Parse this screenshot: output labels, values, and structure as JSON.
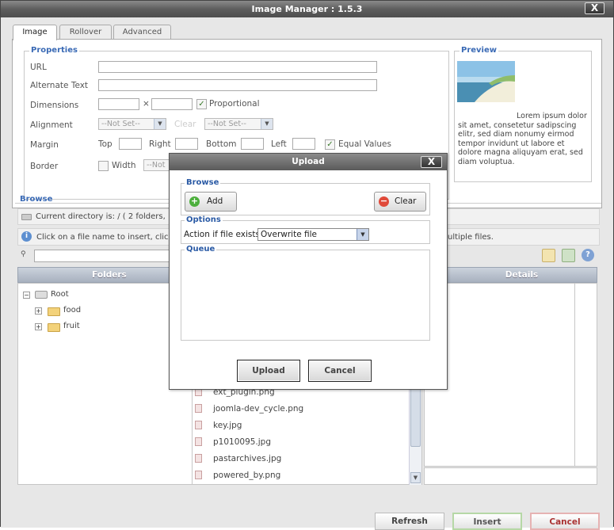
{
  "window": {
    "title": "Image Manager : 1.5.3",
    "close_label": "X"
  },
  "tabs": [
    {
      "label": "Image",
      "active": true
    },
    {
      "label": "Rollover"
    },
    {
      "label": "Advanced"
    }
  ],
  "properties": {
    "legend": "Properties",
    "url_label": "URL",
    "alt_label": "Alternate Text",
    "dimensions_label": "Dimensions",
    "dim_separator": "×",
    "proportional_label": "Proportional",
    "alignment_label": "Alignment",
    "alignment_value": "--Not Set--",
    "clear_label": "Clear",
    "clear_value": "--Not Set--",
    "margin_label": "Margin",
    "top_label": "Top",
    "right_label": "Right",
    "bottom_label": "Bottom",
    "left_label": "Left",
    "equal_values_label": "Equal Values",
    "border_label": "Border",
    "width_label": "Width",
    "width_value": "--Not"
  },
  "preview": {
    "legend": "Preview",
    "text": "Lorem ipsum dolor sit amet, consetetur sadipscing elitr, sed diam nonumy eirmod tempor invidunt ut labore et dolore magna aliquyam erat, sed diam voluptua."
  },
  "browse": {
    "legend": "Browse",
    "current_dir": "Current directory is: / ( 2 folders,",
    "info_left": "Click on a file name to insert, clic",
    "info_right": "ultiple files.",
    "folders_header": "Folders",
    "details_header": "Details",
    "tree": {
      "root": "Root",
      "folders": [
        "food",
        "fruit"
      ]
    },
    "files": [
      "ext_plugin.png",
      "joomla-dev_cycle.png",
      "key.jpg",
      "p1010095.jpg",
      "pastarchives.jpg",
      "powered_by.png"
    ]
  },
  "footer": {
    "refresh": "Refresh",
    "insert": "Insert",
    "cancel": "Cancel"
  },
  "upload_dialog": {
    "title": "Upload",
    "close_label": "X",
    "browse_legend": "Browse",
    "add_label": "Add",
    "clear_label": "Clear",
    "options_legend": "Options",
    "action_label": "Action if file exists:",
    "action_value": "Overwrite file",
    "queue_legend": "Queue",
    "upload_button": "Upload",
    "cancel_button": "Cancel"
  }
}
